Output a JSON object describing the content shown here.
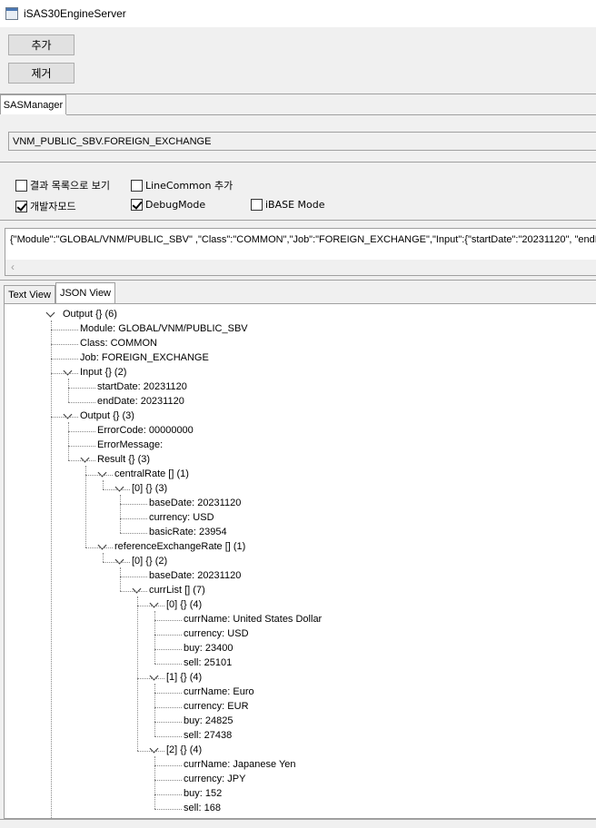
{
  "window": {
    "title": "iSAS30EngineServer"
  },
  "buttons": {
    "add": "추가",
    "remove": "제거"
  },
  "main_tab": "SASManager",
  "module_path": "VNM_PUBLIC_SBV.FOREIGN_EXCHANGE",
  "options": {
    "result_list_view": {
      "label": "결과 목록으로 보기",
      "checked": false
    },
    "line_common_add": {
      "label": "LineCommon 추가",
      "checked": false
    },
    "developer_mode": {
      "label": "개발자모드",
      "checked": true
    },
    "debug_mode": {
      "label": "DebugMode",
      "checked": true
    },
    "ibase_mode": {
      "label": "iBASE Mode",
      "checked": false
    }
  },
  "request_json": "{\"Module\":\"GLOBAL/VNM/PUBLIC_SBV\" ,\"Class\":\"COMMON\",\"Job\":\"FOREIGN_EXCHANGE\",\"Input\":{\"startDate\":\"20231120\", \"endDate\"",
  "view_tabs": {
    "text_view": "Text View",
    "json_view": "JSON View"
  },
  "tree": [
    "Output {} (6)",
    "Module: GLOBAL/VNM/PUBLIC_SBV",
    "Class: COMMON",
    "Job: FOREIGN_EXCHANGE",
    "Input {} (2)",
    "startDate: 20231120",
    "endDate: 20231120",
    "Output {} (3)",
    "ErrorCode: 00000000",
    "ErrorMessage:",
    "Result {} (3)",
    "centralRate [] (1)",
    "[0] {} (3)",
    "baseDate: 20231120",
    "currency: USD",
    "basicRate: 23954",
    "referenceExchangeRate [] (1)",
    "[0] {} (2)",
    "baseDate: 20231120",
    "currList [] (7)",
    "[0] {} (4)",
    "currName: United States Dollar",
    "currency: USD",
    "buy: 23400",
    "sell: 25101",
    "[1] {} (4)",
    "currName: Euro",
    "currency: EUR",
    "buy: 24825",
    "sell: 27438",
    "[2] {} (4)",
    "currName: Japanese Yen",
    "currency: JPY",
    "buy: 152",
    "sell: 168"
  ]
}
